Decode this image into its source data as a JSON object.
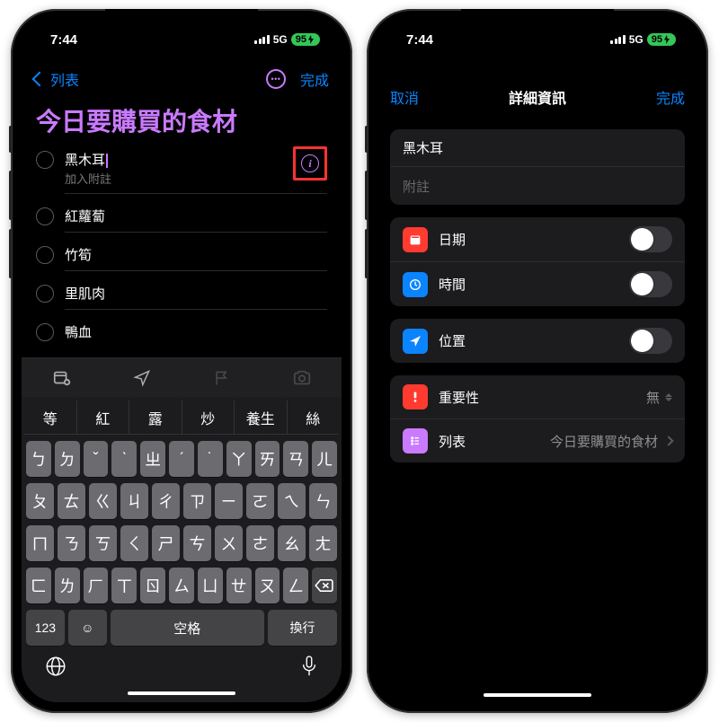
{
  "status": {
    "time": "7:44",
    "network": "5G",
    "battery": "95"
  },
  "left": {
    "nav": {
      "back": "列表",
      "done": "完成"
    },
    "title": "今日要購買的食材",
    "editing_note_placeholder": "加入附註",
    "items": [
      "黑木耳",
      "紅蘿蔔",
      "竹筍",
      "里肌肉",
      "鴨血"
    ],
    "suggestions": [
      "等",
      "紅",
      "露",
      "炒",
      "養生",
      "絲"
    ],
    "keys": {
      "r1": [
        "ㄅ",
        "ㄉ",
        "ˇ",
        "ˋ",
        "ㄓ",
        "ˊ",
        "˙",
        "ㄚ",
        "ㄞ",
        "ㄢ",
        "ㄦ"
      ],
      "r2": [
        "ㄆ",
        "ㄊ",
        "ㄍ",
        "ㄐ",
        "ㄔ",
        "ㄗ",
        "ㄧ",
        "ㄛ",
        "ㄟ",
        "ㄣ"
      ],
      "r3": [
        "ㄇ",
        "ㄋ",
        "ㄎ",
        "ㄑ",
        "ㄕ",
        "ㄘ",
        "ㄨ",
        "ㄜ",
        "ㄠ",
        "ㄤ"
      ],
      "r4": [
        "ㄈ",
        "ㄌ",
        "ㄏ",
        "ㄒ",
        "ㄖ",
        "ㄙ",
        "ㄩ",
        "ㄝ",
        "ㄡ",
        "ㄥ"
      ],
      "numkey": "123",
      "space": "空格",
      "return": "換行"
    }
  },
  "right": {
    "nav": {
      "cancel": "取消",
      "title": "詳細資訊",
      "done": "完成"
    },
    "name": "黑木耳",
    "notes_placeholder": "附註",
    "rows": {
      "date": "日期",
      "time": "時間",
      "location": "位置",
      "priority": "重要性",
      "priority_val": "無",
      "list": "列表",
      "list_val": "今日要購買的食材"
    }
  }
}
